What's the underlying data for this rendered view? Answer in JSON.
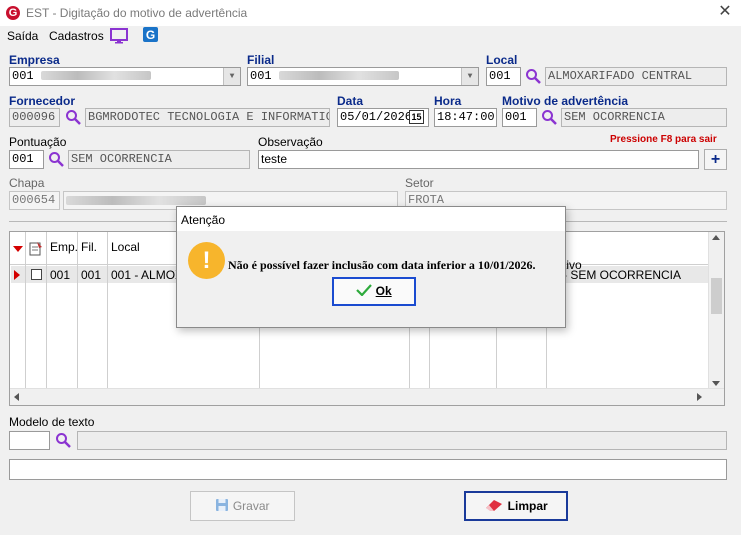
{
  "window": {
    "app_icon": "G",
    "title": "EST - Digitação do motivo de advertência",
    "close": "✕"
  },
  "menu": {
    "saida": "Saída",
    "cadastros": "Cadastros"
  },
  "empresa": {
    "label": "Empresa",
    "value": "001"
  },
  "filial": {
    "label": "Filial",
    "value": "001"
  },
  "local": {
    "label": "Local",
    "code": "001",
    "desc": "ALMOXARIFADO CENTRAL"
  },
  "fornecedor": {
    "label": "Fornecedor",
    "code": "000096",
    "desc": "BGMRODOTEC TECNOLOGIA E INFORMATICA S"
  },
  "data": {
    "label": "Data",
    "value": "05/01/2026",
    "calendar": "15"
  },
  "hora": {
    "label": "Hora",
    "value": "18:47:00"
  },
  "motivo": {
    "label": "Motivo de advertência",
    "code": "001",
    "desc": "SEM OCORRENCIA"
  },
  "pontuacao": {
    "label": "Pontuação",
    "code": "001",
    "desc": "SEM OCORRENCIA"
  },
  "observacao": {
    "label": "Observação",
    "value": "teste",
    "add": "+"
  },
  "hint": "Pressione F8 para sair",
  "chapa": {
    "label": "Chapa",
    "value": "000654"
  },
  "setor": {
    "label": "Setor",
    "value": "FROTA"
  },
  "grid": {
    "headers": {
      "emp": "Emp.",
      "fil": "Fil.",
      "local": "Local",
      "motivo": "tivo"
    },
    "row": {
      "emp": "001",
      "fil": "001",
      "local": "001 - ALMOX",
      "motivo": "- SEM OCORRENCIA"
    }
  },
  "modelo": {
    "label": "Modelo de texto",
    "value": ""
  },
  "buttons": {
    "gravar": "Gravar",
    "limpar": "Limpar"
  },
  "dialog": {
    "title": "Atenção",
    "icon": "!",
    "message": "Não é possível fazer inclusão com data inferior a 10/01/2026.",
    "ok": "Ok"
  },
  "colors": {
    "label_blue": "#0a2a8a",
    "hint_red": "#cc0000",
    "icon_purple": "#8b34d1",
    "warn_orange": "#f7b52c"
  }
}
